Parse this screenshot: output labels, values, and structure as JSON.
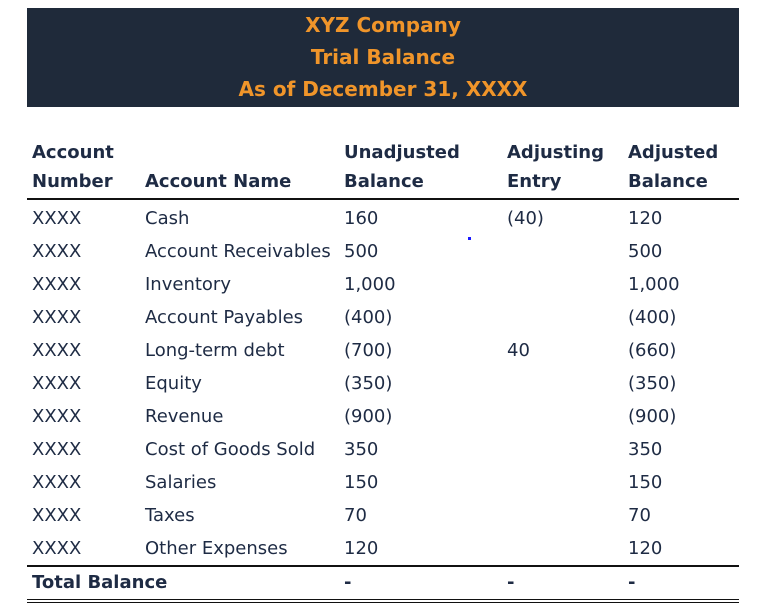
{
  "banner": {
    "company": "XYZ Company",
    "title": "Trial Balance",
    "date": "As of December 31, XXXX"
  },
  "colors": {
    "banner_bg": "#1f2a3a",
    "banner_text": "#f0952a",
    "text": "#1e2b44"
  },
  "table": {
    "headers": {
      "account_number": [
        "Account",
        "Number"
      ],
      "account_name": "Account Name",
      "unadjusted": [
        "Unadjusted",
        "Balance"
      ],
      "adjusting": [
        "Adjusting",
        "Entry"
      ],
      "adjusted": [
        "Adjusted",
        "Balance"
      ]
    },
    "rows": [
      {
        "number": "XXXX",
        "name": "Cash",
        "unadjusted": "160",
        "adjusting": "(40)",
        "adjusted": "120"
      },
      {
        "number": "XXXX",
        "name": "Account Receivables",
        "unadjusted": "500",
        "adjusting": "",
        "adjusted": "500"
      },
      {
        "number": "XXXX",
        "name": "Inventory",
        "unadjusted": "1,000",
        "adjusting": "",
        "adjusted": "1,000"
      },
      {
        "number": "XXXX",
        "name": "Account Payables",
        "unadjusted": "(400)",
        "adjusting": "",
        "adjusted": "(400)"
      },
      {
        "number": "XXXX",
        "name": "Long-term debt",
        "unadjusted": "(700)",
        "adjusting": "40",
        "adjusted": "(660)"
      },
      {
        "number": "XXXX",
        "name": "Equity",
        "unadjusted": "(350)",
        "adjusting": "",
        "adjusted": "(350)"
      },
      {
        "number": "XXXX",
        "name": "Revenue",
        "unadjusted": "(900)",
        "adjusting": "",
        "adjusted": "(900)"
      },
      {
        "number": "XXXX",
        "name": "Cost of Goods Sold",
        "unadjusted": "350",
        "adjusting": "",
        "adjusted": "350"
      },
      {
        "number": "XXXX",
        "name": "Salaries",
        "unadjusted": "150",
        "adjusting": "",
        "adjusted": "150"
      },
      {
        "number": "XXXX",
        "name": "Taxes",
        "unadjusted": "70",
        "adjusting": "",
        "adjusted": "70"
      },
      {
        "number": "XXXX",
        "name": "Other Expenses",
        "unadjusted": "120",
        "adjusting": "",
        "adjusted": "120"
      }
    ],
    "total": {
      "label": "Total Balance",
      "unadjusted": "-",
      "adjusting": "-",
      "adjusted": "-"
    }
  }
}
